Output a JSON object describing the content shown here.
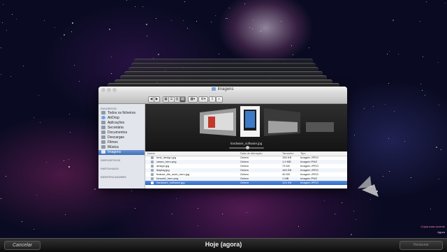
{
  "window": {
    "title": "Imagens",
    "toolbar_buttons": [
      "◀",
      "▶",
      "▦",
      "☰",
      "▥",
      "▤",
      "▦▾",
      "⚙▾",
      "⇪",
      "◐"
    ]
  },
  "sidebar": {
    "favorites_header": "FAVORITOS",
    "favorites": [
      {
        "label": "Todos os ficheiros",
        "icon": "all-files-icon"
      },
      {
        "label": "AirDrop",
        "icon": "airdrop-icon"
      },
      {
        "label": "Aplicações",
        "icon": "applications-icon"
      },
      {
        "label": "Secretária",
        "icon": "desktop-icon"
      },
      {
        "label": "Documentos",
        "icon": "documents-icon"
      },
      {
        "label": "Descargas",
        "icon": "downloads-icon"
      },
      {
        "label": "Filmes",
        "icon": "movies-icon"
      },
      {
        "label": "Música",
        "icon": "music-icon"
      },
      {
        "label": "Imagens",
        "icon": "pictures-icon",
        "selected": true
      }
    ],
    "devices_header": "DISPOSITIVOS",
    "shared_header": "PARTILHADO",
    "tags_header": "IDENTIFICADORES"
  },
  "preview": {
    "caption": "hardware_software.jpg"
  },
  "file_list": {
    "columns": [
      "Nome",
      "Data de alteração",
      "Tamanho",
      "Tipo"
    ],
    "rows": [
      {
        "name": "best_design.jpg",
        "date": "Ontem",
        "size": "155 KB",
        "kind": "Imagem JPEG"
      },
      {
        "name": "cases_hero.png",
        "date": "Ontem",
        "size": "1,9 MB",
        "kind": "Imagem PNG"
      },
      {
        "name": "design.jpg",
        "date": "Ontem",
        "size": "73 KB",
        "kind": "Imagem JPEG"
      },
      {
        "name": "display.jpg",
        "date": "Ontem",
        "size": "169 KB",
        "kind": "Imagem JPEG"
      },
      {
        "name": "feature_life_work_hero.jpg",
        "date": "Ontem",
        "size": "49 KB",
        "kind": "Imagem JPEG"
      },
      {
        "name": "forward_hero.png",
        "date": "Ontem",
        "size": "1 MB",
        "kind": "Imagem PNG"
      },
      {
        "name": "hardware_software.jpg",
        "date": "Ontem",
        "size": "124 KB",
        "kind": "Imagem JPEG",
        "selected": true
      }
    ]
  },
  "bottom_bar": {
    "cancel_label": "Cancelar",
    "date_label": "Hoje (agora)",
    "restore_label": "Restaurar"
  },
  "timeline": {
    "labels": [
      "Cópia mais recente",
      "Agora"
    ]
  },
  "colors": {
    "selection_blue": "#3f6fb8",
    "timeline_pink": "#ff7fb8"
  }
}
